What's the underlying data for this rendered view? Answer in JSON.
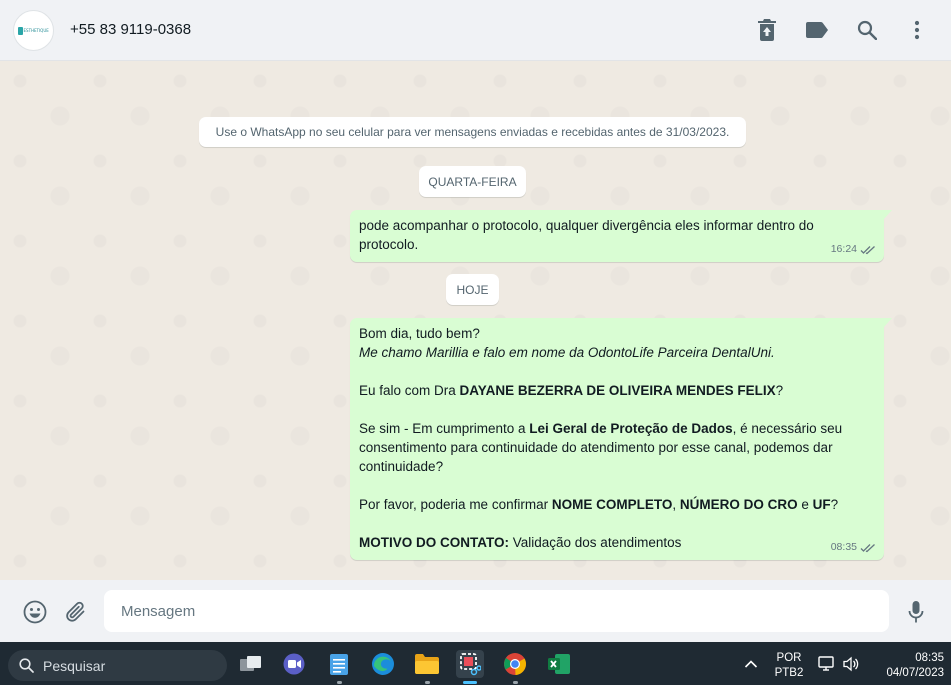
{
  "header": {
    "avatar_text": "ESTHETIQUE",
    "contact_name": "+55 83 9119-0368",
    "icons": [
      "delete-icon",
      "label-icon",
      "search-icon",
      "menu-icon"
    ]
  },
  "chat": {
    "system_note": "Use o WhatsApp no seu celular para ver mensagens enviadas e recebidas antes de 31/03/2023.",
    "day_wednesday": "QUARTA-FEIRA",
    "day_today": "HOJE",
    "message1": {
      "text": "pode acompanhar o protocolo, qualquer divergência eles informar dentro do protocolo.",
      "time": "16:24"
    },
    "message2": {
      "line1": "Bom dia, tudo bem?",
      "line2": "Me chamo Marillia e falo em nome da OdontoLife Parceira DentalUni.",
      "p2_pre": "Eu falo com Dra ",
      "p2_name": "DAYANE BEZERRA DE OLIVEIRA MENDES FELIX",
      "p2_post": "?",
      "p3_pre": "Se sim - Em cumprimento a ",
      "p3_law": "Lei Geral de Proteção de Dados",
      "p3_post": ", é necessário seu consentimento para continuidade do atendimento por esse canal, podemos dar continuidade?",
      "p4_pre": "Por favor, poderia me confirmar ",
      "p4_name": "NOME COMPLETO",
      "p4_sep": ", ",
      "p4_cro": "NÚMERO DO CRO",
      "p4_and": " e ",
      "p4_uf": "UF",
      "p4_post": "?",
      "p5_label": "MOTIVO DO CONTATO:",
      "p5_text": " Validação dos atendimentos",
      "time": "08:35"
    }
  },
  "composer": {
    "placeholder": "Mensagem",
    "icons": [
      "emoji-icon",
      "attach-icon",
      "microphone-icon"
    ]
  },
  "taskbar": {
    "search_label": "Pesquisar",
    "language_line1": "POR",
    "language_line2": "PTB2",
    "clock_time": "08:35",
    "clock_date": "04/07/2023"
  },
  "colors": {
    "outgoing_bubble": "#d9fdd3",
    "chat_background": "#efeae2",
    "header_background": "#f0f2f5",
    "read_ticks": "#667781",
    "taskbar": "#1f2a33"
  }
}
